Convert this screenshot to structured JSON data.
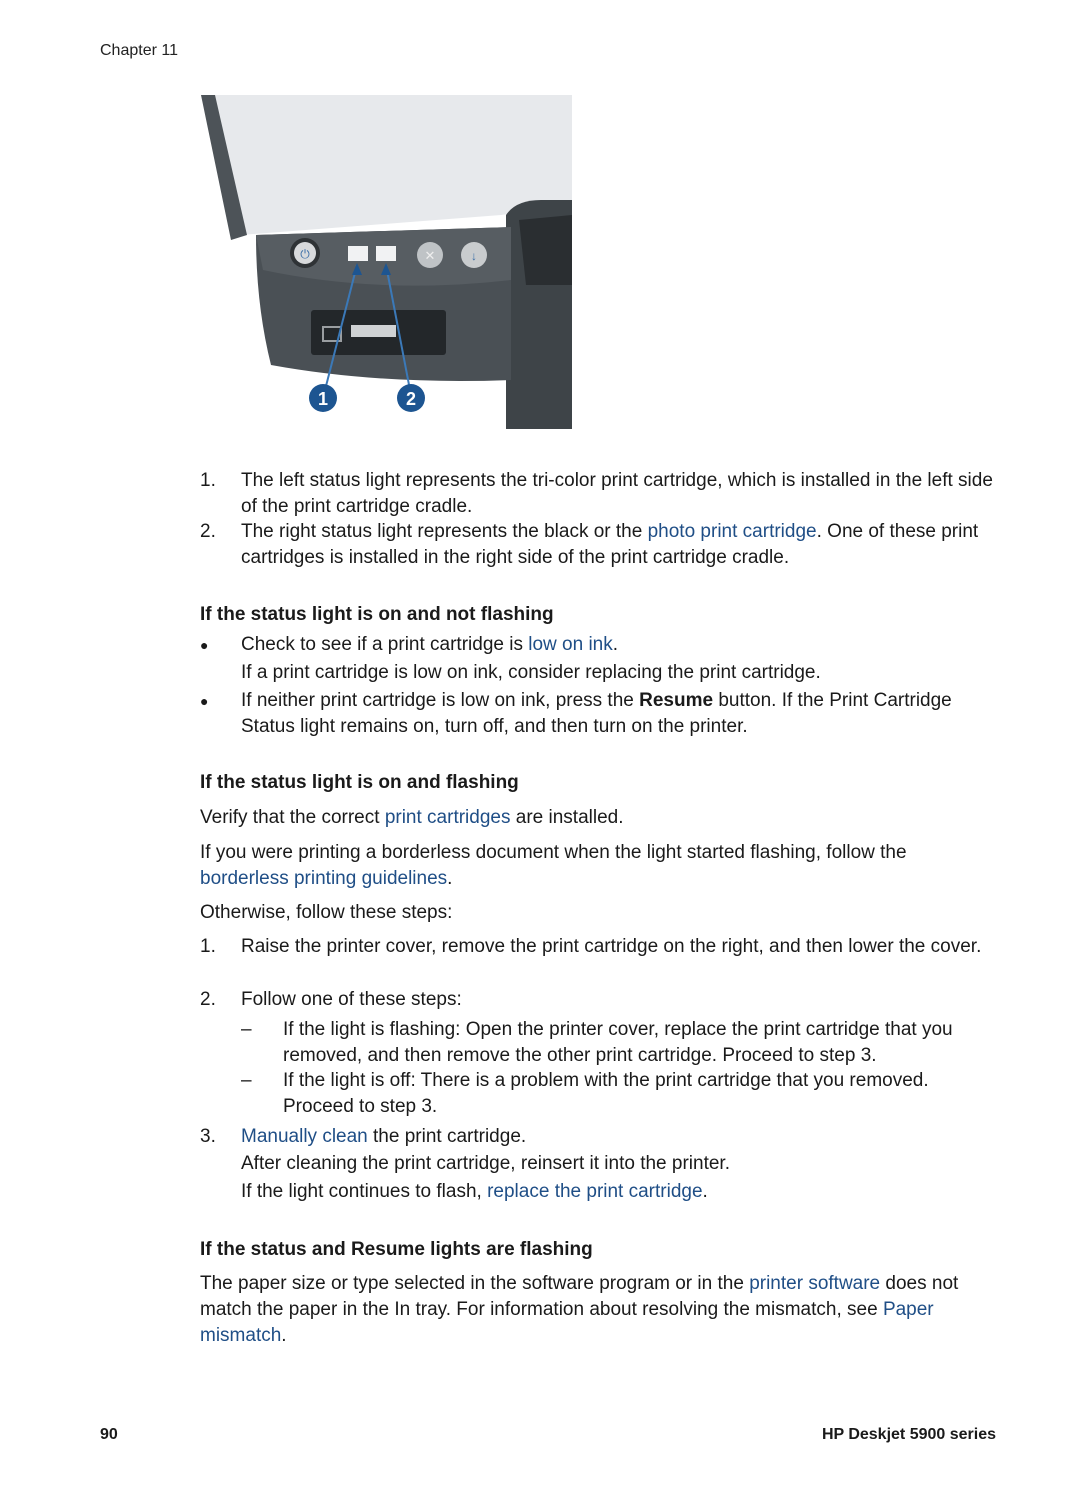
{
  "header": {
    "chapter": "Chapter 11"
  },
  "figure": {
    "description": "Printer control panel with print cartridge status lights",
    "callouts": [
      "1",
      "2"
    ],
    "callout_color": "#1d5591"
  },
  "intro_list": [
    {
      "num": "1.",
      "parts": [
        "The left status light represents the tri-color print cartridge, which is installed in the left side of the print cartridge cradle."
      ]
    },
    {
      "num": "2.",
      "pre": "The right status light represents the black or the ",
      "link": "photo print cartridge",
      "post": ". One of these print cartridges is installed in the right side of the print cartridge cradle."
    }
  ],
  "section1": {
    "heading": "If the status light is on and not flashing",
    "bullets": [
      {
        "pre": "Check to see if a print cartridge is ",
        "link": "low on ink",
        "post": ".",
        "note": "If a print cartridge is low on ink, consider replacing the print cartridge."
      },
      {
        "pre": "If neither print cartridge is low on ink, press the ",
        "bold": "Resume",
        "post": " button. If the Print Cartridge Status light remains on, turn off, and then turn on the printer."
      }
    ],
    "bullet_glyph": "●"
  },
  "section2": {
    "heading": "If the status light is on and flashing",
    "p1": {
      "pre": "Verify that the correct ",
      "link": "print cartridges",
      "post": " are installed."
    },
    "p2": {
      "pre": "If you were printing a borderless document when the light started flashing, follow the ",
      "link": "borderless printing guidelines",
      "post": "."
    },
    "p3": "Otherwise, follow these steps:",
    "steps": [
      {
        "num": "1.",
        "text": "Raise the printer cover, remove the print cartridge on the right, and then lower the cover."
      },
      {
        "num": "2.",
        "text": "Follow one of these steps:",
        "sub": [
          {
            "dash": "–",
            "text": "If the light is flashing: Open the printer cover, replace the print cartridge that you removed, and then remove the other print cartridge. Proceed to step 3."
          },
          {
            "dash": "–",
            "text": "If the light is off: There is a problem with the print cartridge that you removed. Proceed to step 3."
          }
        ]
      },
      {
        "num": "3.",
        "link": "Manually clean",
        "post": " the print cartridge.",
        "note1": "After cleaning the print cartridge, reinsert it into the printer.",
        "note2_pre": "If the light continues to flash, ",
        "note2_link": "replace the print cartridge",
        "note2_post": "."
      }
    ]
  },
  "section3": {
    "heading": "If the status and Resume lights are flashing",
    "p": {
      "pre": "The paper size or type selected in the software program or in the ",
      "link1": "printer software",
      "mid": " does not match the paper in the In tray. For information about resolving the mismatch, see ",
      "link2": "Paper mismatch",
      "post": "."
    }
  },
  "footer": {
    "page_number": "90",
    "product": "HP Deskjet 5900 series"
  },
  "colors": {
    "link": "#1f4e86",
    "text": "#1a1a1a"
  }
}
